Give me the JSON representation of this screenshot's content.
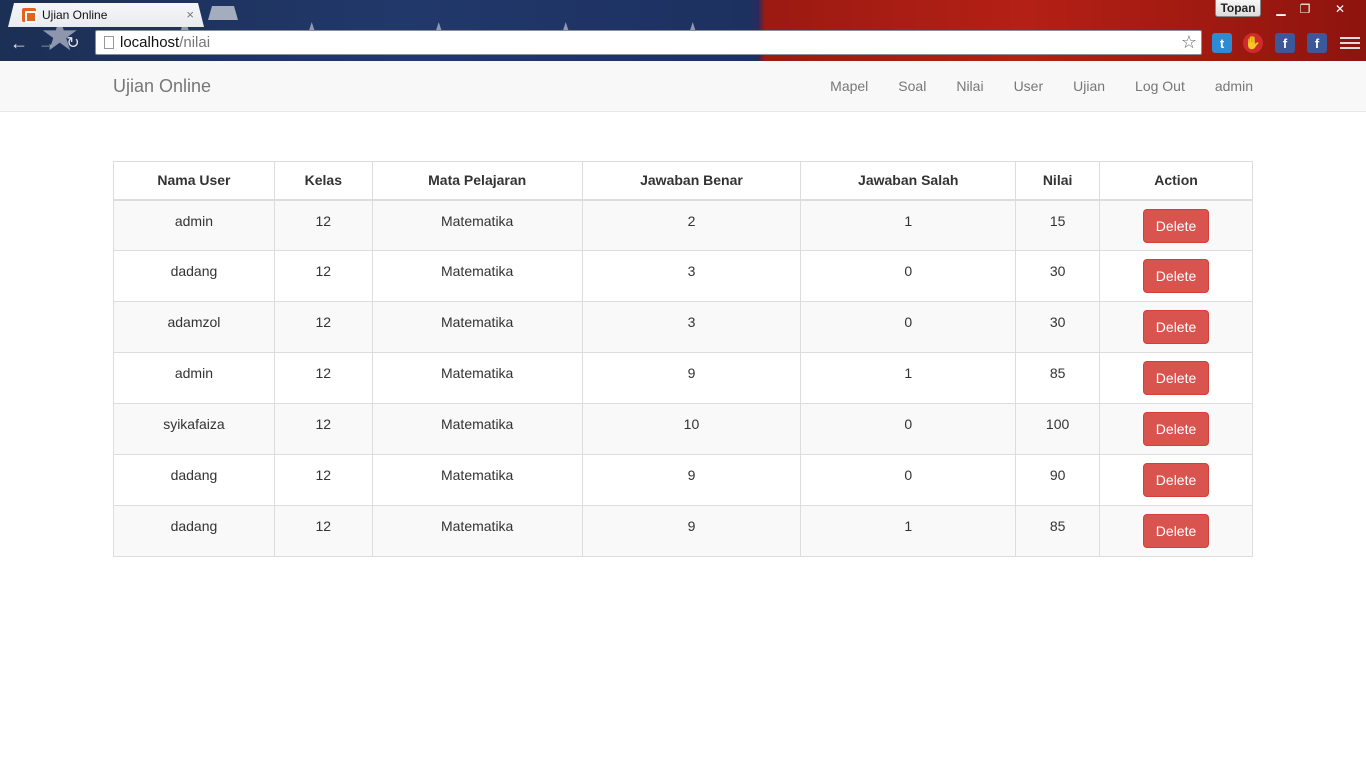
{
  "browser": {
    "tab_title": "Ujian Online",
    "tab_close": "×",
    "profile_name": "Topan",
    "url_host": "localhost",
    "url_path": "/nilai",
    "window_controls": {
      "minimize": "▁",
      "maximize": "❐",
      "close": "✕"
    },
    "extensions": [
      "twitter-icon",
      "stop-icon",
      "facebook-icon",
      "facebook-icon"
    ]
  },
  "navbar": {
    "brand": "Ujian Online",
    "links": [
      "Mapel",
      "Soal",
      "Nilai",
      "User",
      "Ujian",
      "Log Out",
      "admin"
    ]
  },
  "table": {
    "columns": [
      "Nama User",
      "Kelas",
      "Mata Pelajaran",
      "Jawaban Benar",
      "Jawaban Salah",
      "Nilai",
      "Action"
    ],
    "rows": [
      {
        "nama": "admin",
        "kelas": "12",
        "mapel": "Matematika",
        "benar": "2",
        "salah": "1",
        "nilai": "15",
        "action": "Delete"
      },
      {
        "nama": "dadang",
        "kelas": "12",
        "mapel": "Matematika",
        "benar": "3",
        "salah": "0",
        "nilai": "30",
        "action": "Delete"
      },
      {
        "nama": "adamzol",
        "kelas": "12",
        "mapel": "Matematika",
        "benar": "3",
        "salah": "0",
        "nilai": "30",
        "action": "Delete"
      },
      {
        "nama": "admin",
        "kelas": "12",
        "mapel": "Matematika",
        "benar": "9",
        "salah": "1",
        "nilai": "85",
        "action": "Delete"
      },
      {
        "nama": "syikafaiza",
        "kelas": "12",
        "mapel": "Matematika",
        "benar": "10",
        "salah": "0",
        "nilai": "100",
        "action": "Delete"
      },
      {
        "nama": "dadang",
        "kelas": "12",
        "mapel": "Matematika",
        "benar": "9",
        "salah": "0",
        "nilai": "90",
        "action": "Delete"
      },
      {
        "nama": "dadang",
        "kelas": "12",
        "mapel": "Matematika",
        "benar": "9",
        "salah": "1",
        "nilai": "85",
        "action": "Delete"
      }
    ]
  },
  "colors": {
    "delete_button": "#d9534f",
    "navbar_bg": "#f8f8f8"
  }
}
